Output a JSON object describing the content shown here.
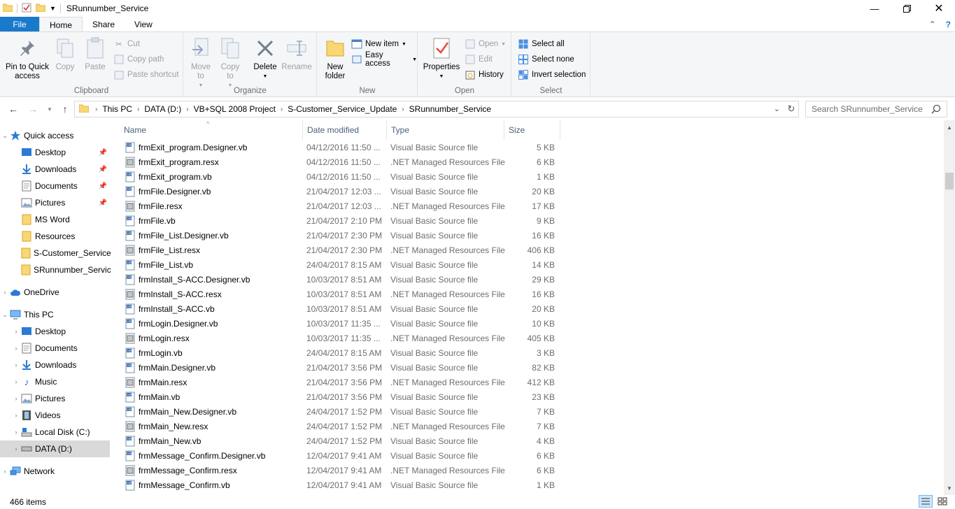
{
  "window": {
    "title": "SRunnumber_Service"
  },
  "tabs": [
    {
      "label": "File"
    },
    {
      "label": "Home"
    },
    {
      "label": "Share"
    },
    {
      "label": "View"
    }
  ],
  "ribbon": {
    "clipboard": {
      "label": "Clipboard",
      "pin": "Pin to Quick access",
      "copy": "Copy",
      "paste": "Paste",
      "cut": "Cut",
      "copy_path": "Copy path",
      "paste_shortcut": "Paste shortcut"
    },
    "organize": {
      "label": "Organize",
      "move_to": "Move to",
      "copy_to": "Copy to",
      "delete": "Delete",
      "rename": "Rename"
    },
    "new": {
      "label": "New",
      "new_folder": "New folder",
      "new_item": "New item",
      "easy_access": "Easy access"
    },
    "open": {
      "label": "Open",
      "properties": "Properties",
      "open": "Open",
      "edit": "Edit",
      "history": "History"
    },
    "select": {
      "label": "Select",
      "select_all": "Select all",
      "select_none": "Select none",
      "invert": "Invert selection"
    }
  },
  "address": {
    "crumbs": [
      "This PC",
      "DATA (D:)",
      "VB+SQL 2008 Project",
      "S-Customer_Service_Update",
      "SRunnumber_Service"
    ],
    "search_placeholder": "Search SRunnumber_Service"
  },
  "nav": {
    "quick_access": "Quick access",
    "quick_items": [
      "Desktop",
      "Downloads",
      "Documents",
      "Pictures",
      "MS Word",
      "Resources",
      "S-Customer_Service",
      "SRunnumber_Servic"
    ],
    "onedrive": "OneDrive",
    "this_pc": "This PC",
    "pc_items": [
      "Desktop",
      "Documents",
      "Downloads",
      "Music",
      "Pictures",
      "Videos",
      "Local Disk (C:)",
      "DATA (D:)"
    ],
    "network": "Network"
  },
  "columns": {
    "name": "Name",
    "date": "Date modified",
    "type": "Type",
    "size": "Size"
  },
  "files": [
    {
      "name": "frmExit_program.Designer.vb",
      "date": "04/12/2016 11:50 ...",
      "type": "Visual Basic Source file",
      "size": "5 KB",
      "kind": "vb"
    },
    {
      "name": "frmExit_program.resx",
      "date": "04/12/2016 11:50 ...",
      "type": ".NET Managed Resources File",
      "size": "6 KB",
      "kind": "resx"
    },
    {
      "name": "frmExit_program.vb",
      "date": "04/12/2016 11:50 ...",
      "type": "Visual Basic Source file",
      "size": "1 KB",
      "kind": "vb"
    },
    {
      "name": "frmFile.Designer.vb",
      "date": "21/04/2017 12:03 ...",
      "type": "Visual Basic Source file",
      "size": "20 KB",
      "kind": "vb"
    },
    {
      "name": "frmFile.resx",
      "date": "21/04/2017 12:03 ...",
      "type": ".NET Managed Resources File",
      "size": "17 KB",
      "kind": "resx"
    },
    {
      "name": "frmFile.vb",
      "date": "21/04/2017 2:10 PM",
      "type": "Visual Basic Source file",
      "size": "9 KB",
      "kind": "vb"
    },
    {
      "name": "frmFile_List.Designer.vb",
      "date": "21/04/2017 2:30 PM",
      "type": "Visual Basic Source file",
      "size": "16 KB",
      "kind": "vb"
    },
    {
      "name": "frmFile_List.resx",
      "date": "21/04/2017 2:30 PM",
      "type": ".NET Managed Resources File",
      "size": "406 KB",
      "kind": "resx"
    },
    {
      "name": "frmFile_List.vb",
      "date": "24/04/2017 8:15 AM",
      "type": "Visual Basic Source file",
      "size": "14 KB",
      "kind": "vb"
    },
    {
      "name": "frmInstall_S-ACC.Designer.vb",
      "date": "10/03/2017 8:51 AM",
      "type": "Visual Basic Source file",
      "size": "29 KB",
      "kind": "vb"
    },
    {
      "name": "frmInstall_S-ACC.resx",
      "date": "10/03/2017 8:51 AM",
      "type": ".NET Managed Resources File",
      "size": "16 KB",
      "kind": "resx"
    },
    {
      "name": "frmInstall_S-ACC.vb",
      "date": "10/03/2017 8:51 AM",
      "type": "Visual Basic Source file",
      "size": "20 KB",
      "kind": "vb"
    },
    {
      "name": "frmLogin.Designer.vb",
      "date": "10/03/2017 11:35 ...",
      "type": "Visual Basic Source file",
      "size": "10 KB",
      "kind": "vb"
    },
    {
      "name": "frmLogin.resx",
      "date": "10/03/2017 11:35 ...",
      "type": ".NET Managed Resources File",
      "size": "405 KB",
      "kind": "resx"
    },
    {
      "name": "frmLogin.vb",
      "date": "24/04/2017 8:15 AM",
      "type": "Visual Basic Source file",
      "size": "3 KB",
      "kind": "vb"
    },
    {
      "name": "frmMain.Designer.vb",
      "date": "21/04/2017 3:56 PM",
      "type": "Visual Basic Source file",
      "size": "82 KB",
      "kind": "vb"
    },
    {
      "name": "frmMain.resx",
      "date": "21/04/2017 3:56 PM",
      "type": ".NET Managed Resources File",
      "size": "412 KB",
      "kind": "resx"
    },
    {
      "name": "frmMain.vb",
      "date": "21/04/2017 3:56 PM",
      "type": "Visual Basic Source file",
      "size": "23 KB",
      "kind": "vb"
    },
    {
      "name": "frmMain_New.Designer.vb",
      "date": "24/04/2017 1:52 PM",
      "type": "Visual Basic Source file",
      "size": "7 KB",
      "kind": "vb"
    },
    {
      "name": "frmMain_New.resx",
      "date": "24/04/2017 1:52 PM",
      "type": ".NET Managed Resources File",
      "size": "7 KB",
      "kind": "resx"
    },
    {
      "name": "frmMain_New.vb",
      "date": "24/04/2017 1:52 PM",
      "type": "Visual Basic Source file",
      "size": "4 KB",
      "kind": "vb"
    },
    {
      "name": "frmMessage_Confirm.Designer.vb",
      "date": "12/04/2017 9:41 AM",
      "type": "Visual Basic Source file",
      "size": "6 KB",
      "kind": "vb"
    },
    {
      "name": "frmMessage_Confirm.resx",
      "date": "12/04/2017 9:41 AM",
      "type": ".NET Managed Resources File",
      "size": "6 KB",
      "kind": "resx"
    },
    {
      "name": "frmMessage_Confirm.vb",
      "date": "12/04/2017 9:41 AM",
      "type": "Visual Basic Source file",
      "size": "1 KB",
      "kind": "vb"
    }
  ],
  "status": {
    "count": "466 items"
  },
  "colors": {
    "accent": "#1979ca",
    "header_text": "#4c607a",
    "selected": "#d9d9d9"
  }
}
